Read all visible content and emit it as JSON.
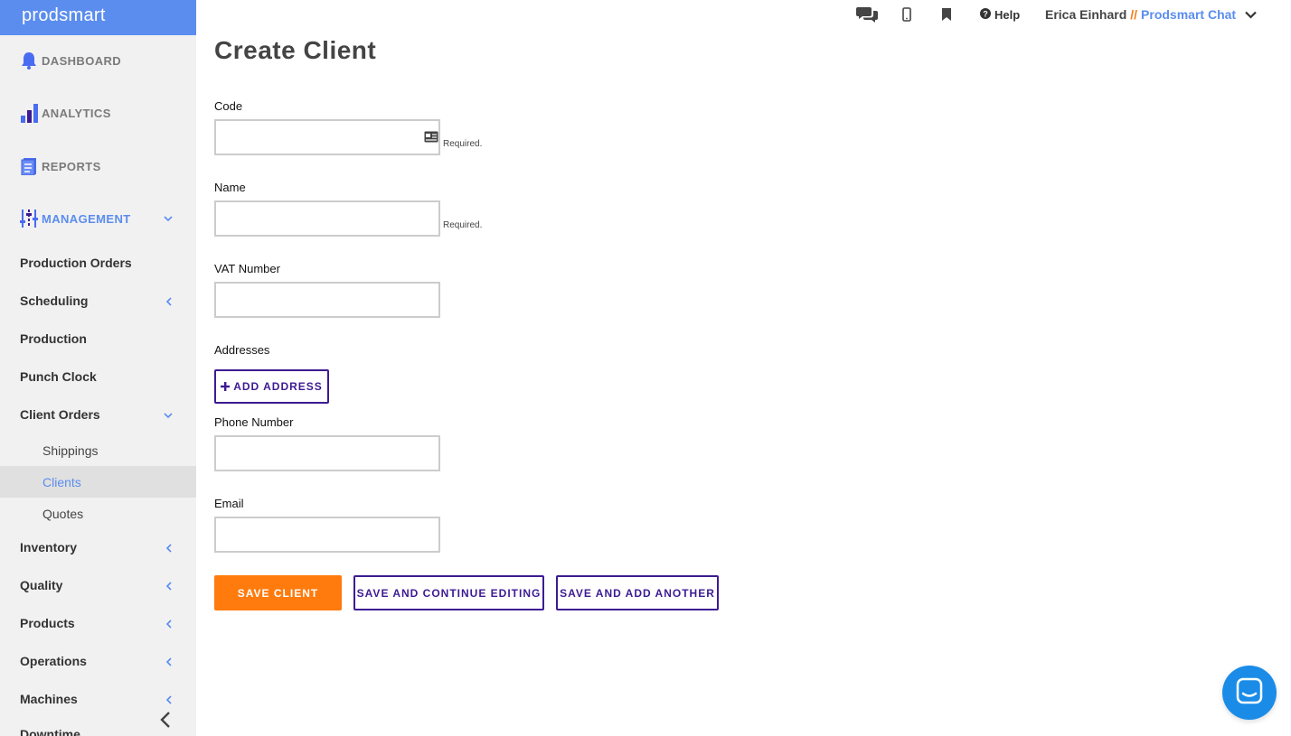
{
  "brand": {
    "logo": "prodsmart"
  },
  "sidebar": {
    "main": [
      {
        "label": "DASHBOARD",
        "icon": "bell-icon"
      },
      {
        "label": "ANALYTICS",
        "icon": "bar-chart-icon"
      },
      {
        "label": "REPORTS",
        "icon": "document-icon"
      },
      {
        "label": "MANAGEMENT",
        "icon": "sliders-icon",
        "active": true
      }
    ],
    "management_items": [
      {
        "label": "Production Orders"
      },
      {
        "label": "Scheduling"
      },
      {
        "label": "Production"
      },
      {
        "label": "Punch Clock"
      },
      {
        "label": "Client Orders"
      },
      {
        "label": "Inventory"
      },
      {
        "label": "Quality"
      },
      {
        "label": "Products"
      },
      {
        "label": "Operations"
      },
      {
        "label": "Machines"
      },
      {
        "label": "Downtime"
      }
    ],
    "client_orders_sub": [
      {
        "label": "Shippings"
      },
      {
        "label": "Clients",
        "selected": true
      },
      {
        "label": "Quotes"
      }
    ]
  },
  "topbar": {
    "help": "Help",
    "user_name": "Erica Einhard",
    "separator": "//",
    "org": "Prodsmart Chat"
  },
  "form": {
    "title": "Create Client",
    "code_label": "Code",
    "name_label": "Name",
    "vat_label": "VAT Number",
    "addresses_label": "Addresses",
    "add_address": "ADD ADDRESS",
    "phone_label": "Phone Number",
    "email_label": "Email",
    "required": "Required.",
    "code_value": "",
    "name_value": "",
    "vat_value": "",
    "phone_value": "",
    "email_value": ""
  },
  "actions": {
    "save": "SAVE CLIENT",
    "save_continue": "SAVE AND CONTINUE EDITING",
    "save_another": "SAVE AND ADD ANOTHER"
  },
  "colors": {
    "brand_blue": "#5b8def",
    "primary_orange": "#ff7b0d",
    "outline_purple": "#3d1b93",
    "chat_blue": "#1a8ce8"
  }
}
